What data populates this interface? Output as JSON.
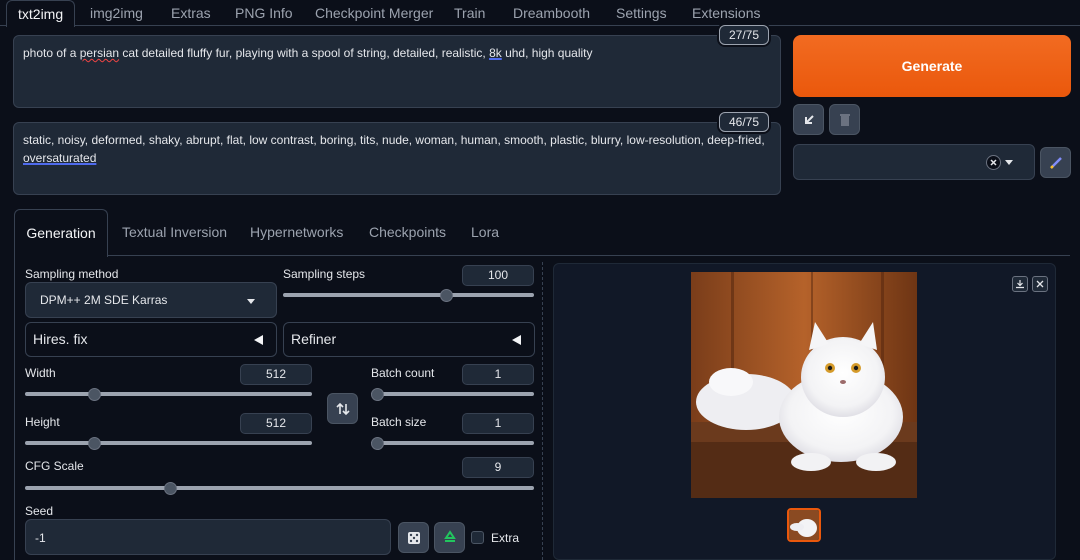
{
  "top_tabs": [
    "txt2img",
    "img2img",
    "Extras",
    "PNG Info",
    "Checkpoint Merger",
    "Train",
    "Dreambooth",
    "Settings",
    "Extensions"
  ],
  "prompt": {
    "text_before": "photo of a ",
    "text_persian": "persian",
    "text_middle": " cat detailed fluffy fur, playing with a spool of string, detailed, realistic, ",
    "text_8k": "8k",
    "text_after": " uhd, high quality",
    "token_count": "27/75"
  },
  "negative_prompt": {
    "text_main": "static, noisy, deformed, shaky, abrupt, flat, low contrast, boring, tits, nude, woman, human, smooth, plastic, blurry, low-resolution, deep-fried, ",
    "text_last": "oversaturated",
    "token_count": "46/75"
  },
  "generate_label": "Generate",
  "panel_tabs": [
    "Generation",
    "Textual Inversion",
    "Hypernetworks",
    "Checkpoints",
    "Lora"
  ],
  "generation": {
    "sampling_method_label": "Sampling method",
    "sampling_method_value": "DPM++ 2M SDE Karras",
    "sampling_steps_label": "Sampling steps",
    "sampling_steps_value": "100",
    "hires_label": "Hires. fix",
    "refiner_label": "Refiner",
    "width_label": "Width",
    "width_value": "512",
    "height_label": "Height",
    "height_value": "512",
    "batch_count_label": "Batch count",
    "batch_count_value": "1",
    "batch_size_label": "Batch size",
    "batch_size_value": "1",
    "cfg_label": "CFG Scale",
    "cfg_value": "9",
    "seed_label": "Seed",
    "seed_value": "-1",
    "extra_label": "Extra"
  },
  "slider_fractions": {
    "sampling_steps": 0.66,
    "width": 0.23,
    "height": 0.23,
    "batch_count": 0.0,
    "batch_size": 0.0,
    "cfg": 0.28
  },
  "icons": {
    "paste": "arrow-down-left-icon",
    "trash": "trash-icon",
    "clear": "x-circle-icon",
    "dropdown": "chevron-down-icon",
    "edit_styles": "pencil-icon",
    "swap": "swap-arrows-icon",
    "dice": "dice-icon",
    "recycle": "recycle-icon",
    "download": "download-icon",
    "close": "close-icon"
  },
  "colors": {
    "accent": "#ea580c",
    "background": "#0b0f19",
    "panel": "#1f2937"
  }
}
